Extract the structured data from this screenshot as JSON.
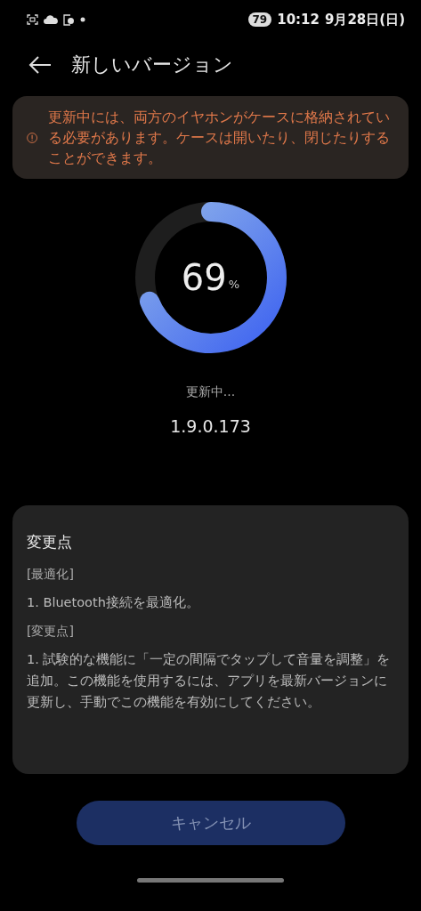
{
  "status_bar": {
    "battery": "79",
    "time": "10:12",
    "date": "9月28日(日)"
  },
  "header": {
    "title": "新しいバージョン"
  },
  "warning": {
    "text": "更新中には、両方のイヤホンがケースに格納されている必要があります。ケースは開いたり、閉じたりすることができます。"
  },
  "progress": {
    "level": 0.69,
    "value": "69",
    "unit": "%",
    "status": "更新中...",
    "version": "1.9.0.173"
  },
  "changes": {
    "title": "変更点",
    "sections": [
      {
        "heading": "[最適化]",
        "items": [
          "1. Bluetooth接続を最適化。"
        ]
      },
      {
        "heading": "[変更点]",
        "items": [
          "1. 試験的な機能に「一定の間隔でタップして音量を調整」を追加。この機能を使用するには、アプリを最新バージョンに更新し、手動でこの機能を有効にしてください。"
        ]
      }
    ]
  },
  "cancel_button": {
    "label": "キャンセル",
    "disabled": true
  }
}
